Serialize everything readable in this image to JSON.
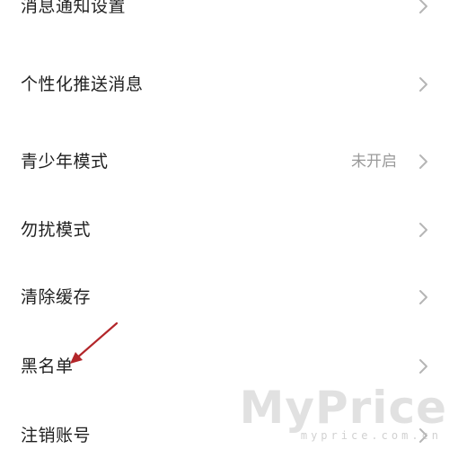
{
  "settings": {
    "items": [
      {
        "label": "消息通知设置",
        "value": ""
      },
      {
        "label": "个性化推送消息",
        "value": ""
      },
      {
        "label": "青少年模式",
        "value": "未开启"
      },
      {
        "label": "勿扰模式",
        "value": ""
      },
      {
        "label": "清除缓存",
        "value": ""
      },
      {
        "label": "黑名单",
        "value": ""
      },
      {
        "label": "注销账号",
        "value": ""
      }
    ]
  },
  "icons": {
    "chevron": "chevron-right-icon",
    "annotation": "red-arrow-annotation"
  },
  "colors": {
    "text": "#1f1f1f",
    "secondary": "#9a9a9a",
    "chevron": "#b5b5b5",
    "annotation": "#b3262a",
    "background": "#ffffff"
  },
  "watermark": {
    "logo": "MyPrice",
    "url": "myprice.com.cn"
  }
}
